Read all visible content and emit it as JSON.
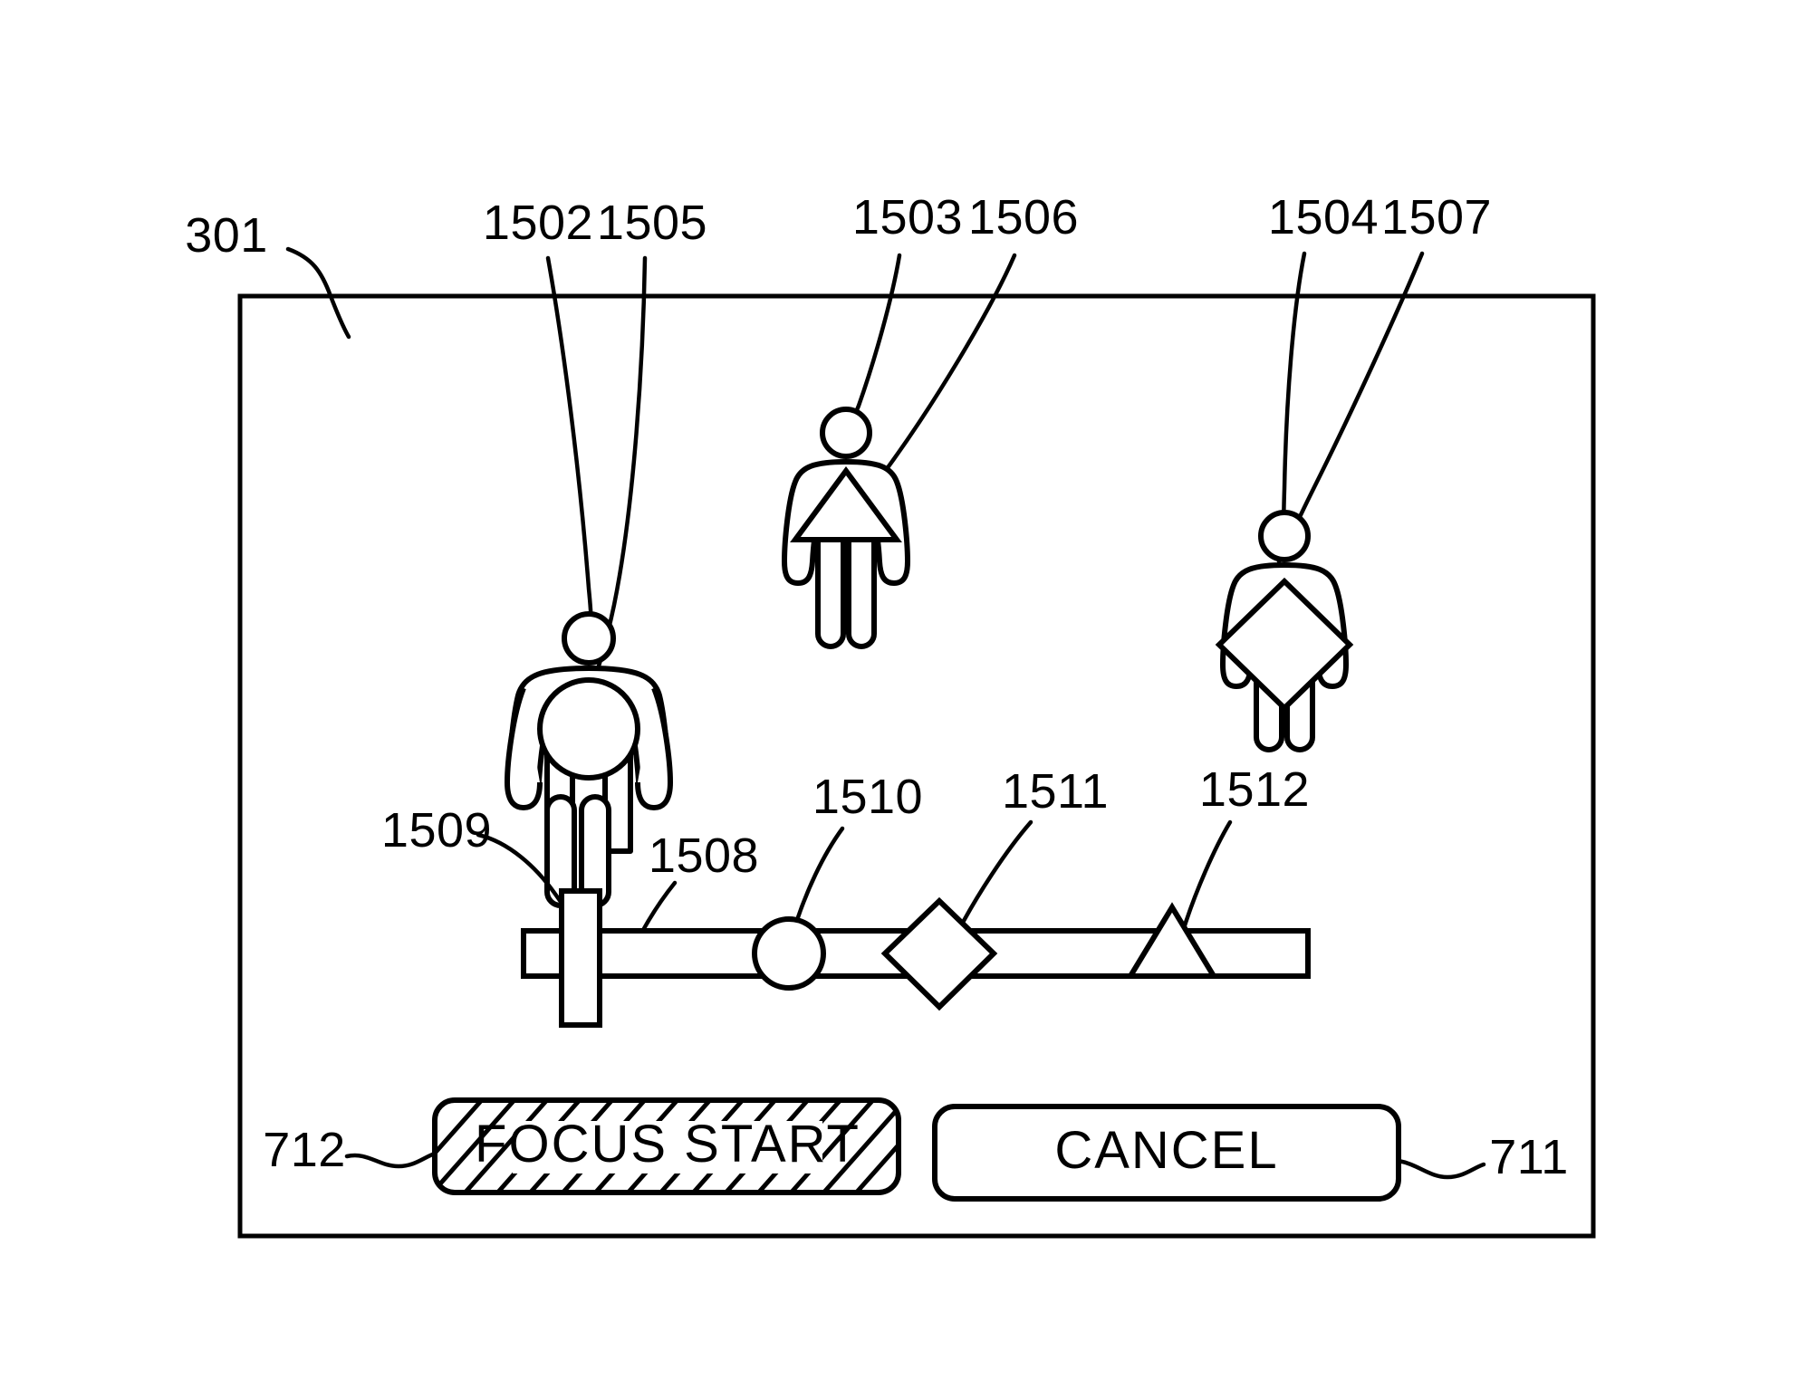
{
  "figure": {
    "frame_label": "301",
    "background_color": "#ffffff",
    "line_color": "#000000"
  },
  "reference_labels": {
    "frame": "301",
    "person_left_head": "1502",
    "person_left_badge": "1505",
    "person_middle_head": "1503",
    "person_middle_badge": "1506",
    "person_right_head": "1504",
    "person_right_badge": "1507",
    "slider_track": "1508",
    "slider_handle": "1509",
    "marker_circle": "1510",
    "marker_diamond": "1511",
    "marker_triangle": "1512",
    "focus_start_ref": "712",
    "cancel_ref": "711"
  },
  "persons": [
    {
      "id": "person-left",
      "head_ref": "1502",
      "badge_ref": "1505",
      "badge_shape": "circle"
    },
    {
      "id": "person-middle",
      "head_ref": "1503",
      "badge_ref": "1506",
      "badge_shape": "triangle"
    },
    {
      "id": "person-right",
      "head_ref": "1504",
      "badge_ref": "1507",
      "badge_shape": "diamond"
    }
  ],
  "slider": {
    "track_ref": "1508",
    "handle_ref": "1509",
    "markers": [
      {
        "ref": "1510",
        "shape": "circle"
      },
      {
        "ref": "1511",
        "shape": "diamond"
      },
      {
        "ref": "1512",
        "shape": "triangle"
      }
    ]
  },
  "buttons": {
    "focus_start": {
      "label": "FOCUS START",
      "ref": "712",
      "state": "selected",
      "fill_pattern": "diagonal-hatch"
    },
    "cancel": {
      "label": "CANCEL",
      "ref": "711",
      "state": "normal",
      "fill_pattern": "none"
    }
  }
}
